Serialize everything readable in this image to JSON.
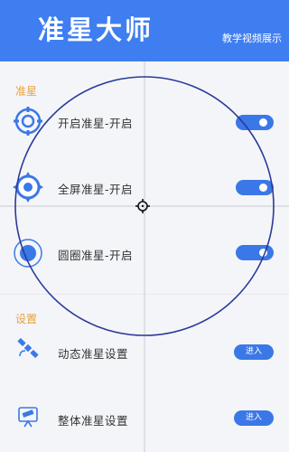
{
  "header": {
    "title": "准星大师",
    "tutorial_link": "教学视频展示"
  },
  "sections": {
    "crosshair_label": "准星",
    "settings_label": "设置"
  },
  "crosshair_rows": [
    {
      "label": "开启准星-开启",
      "icon": "target-ring-icon",
      "toggle_on": true
    },
    {
      "label": "全屏准星-开启",
      "icon": "target-cross-icon",
      "toggle_on": true
    },
    {
      "label": "圆圈准星-开启",
      "icon": "circle-dot-icon",
      "toggle_on": true
    }
  ],
  "settings_rows": [
    {
      "label": "动态准星设置",
      "icon": "satellite-icon",
      "button": "进入"
    },
    {
      "label": "整体准星设置",
      "icon": "telescope-icon",
      "button": "进入"
    }
  ],
  "colors": {
    "header": "#3f7ef0",
    "accent": "#3b78e7",
    "section_label": "#e8a23a",
    "circle_overlay": "#2a3a9a"
  }
}
